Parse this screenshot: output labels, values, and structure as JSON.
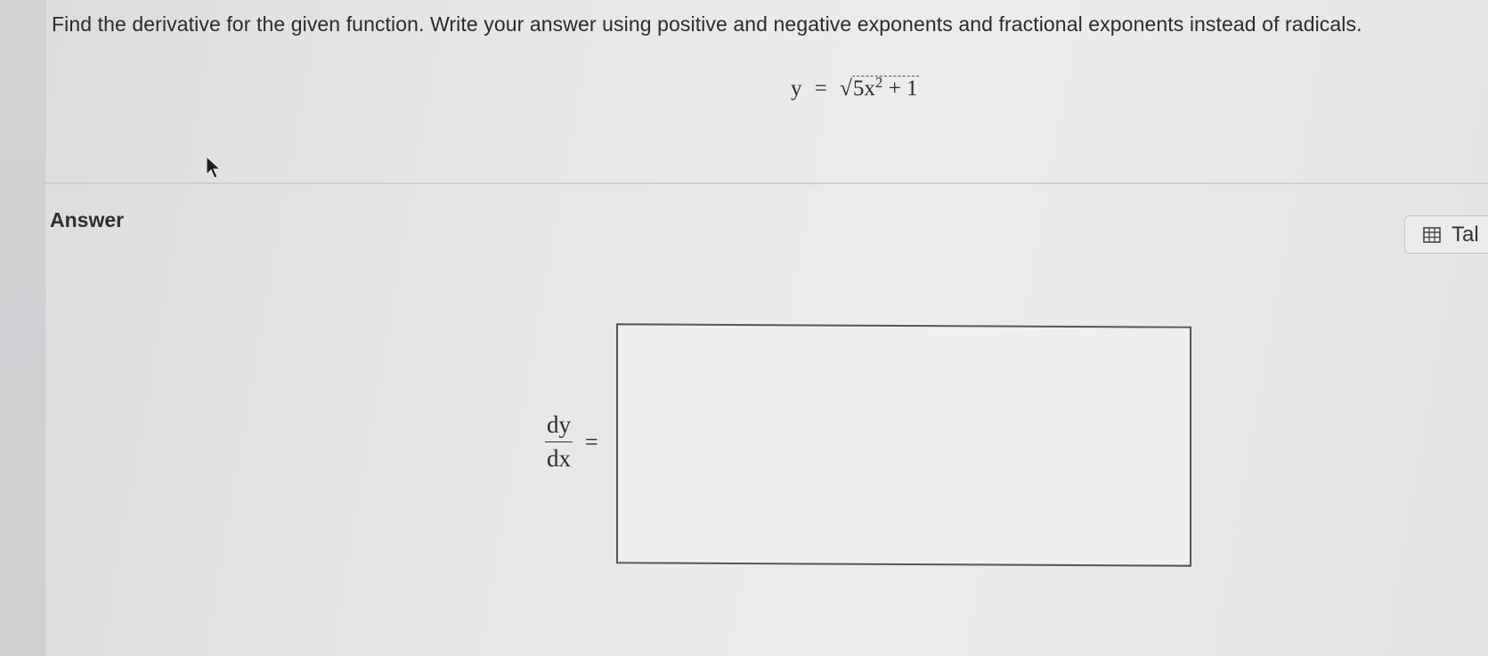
{
  "question": {
    "text": "Find the derivative for the given function. Write your answer using positive and negative exponents and fractional exponents instead of radicals.",
    "equation": {
      "lhs": "y",
      "equals": "=",
      "radical_sign": "√",
      "radicand_base": "5x",
      "radicand_exponent": "2",
      "radicand_rest": "+ 1"
    }
  },
  "answer": {
    "heading": "Answer",
    "table_button_label": "Tal",
    "derivative_numerator": "dy",
    "derivative_denominator": "dx",
    "equals": "=",
    "input_value": ""
  },
  "icons": {
    "table_icon": "table-grid-icon",
    "cursor": "mouse-pointer-icon"
  },
  "colors": {
    "background": "#e6e6e8",
    "text": "#2b2b2b",
    "box_border": "#555555"
  }
}
